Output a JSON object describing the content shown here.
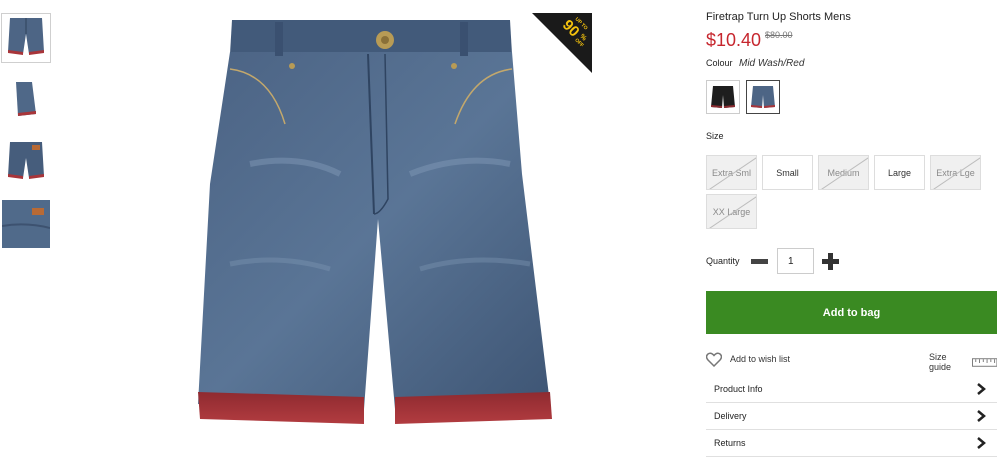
{
  "product": {
    "title": "Firetrap Turn Up Shorts Mens",
    "price": "$10.40",
    "old_price": "$80.00",
    "badge": {
      "line1": "UP TO",
      "line2": "90",
      "line3": "%",
      "line4": "OFF",
      "color": "#1a1a1a",
      "text_color": "#f4c20d"
    }
  },
  "colour": {
    "label": "Colour",
    "selected": "Mid Wash/Red",
    "swatches": [
      {
        "name": "Black",
        "icon": "black-shorts-swatch"
      },
      {
        "name": "Mid Wash/Red",
        "icon": "denim-shorts-swatch",
        "selected": true
      }
    ]
  },
  "size": {
    "label": "Size",
    "options": [
      {
        "label": "Extra Sml",
        "available": false
      },
      {
        "label": "Small",
        "available": true
      },
      {
        "label": "Medium",
        "available": false
      },
      {
        "label": "Large",
        "available": true
      },
      {
        "label": "Extra Lge",
        "available": false
      },
      {
        "label": "XX Large",
        "available": false
      }
    ]
  },
  "quantity": {
    "label": "Quantity",
    "value": "1"
  },
  "actions": {
    "add_to_bag": "Add to bag",
    "wishlist": "Add to wish list",
    "size_guide": "Size guide"
  },
  "accordion": [
    {
      "label": "Product Info"
    },
    {
      "label": "Delivery"
    },
    {
      "label": "Returns"
    }
  ],
  "colors": {
    "price": "#c6262e",
    "add_button": "#3a8a22",
    "denim": "#4a6080",
    "turnup": "#a8353a"
  }
}
